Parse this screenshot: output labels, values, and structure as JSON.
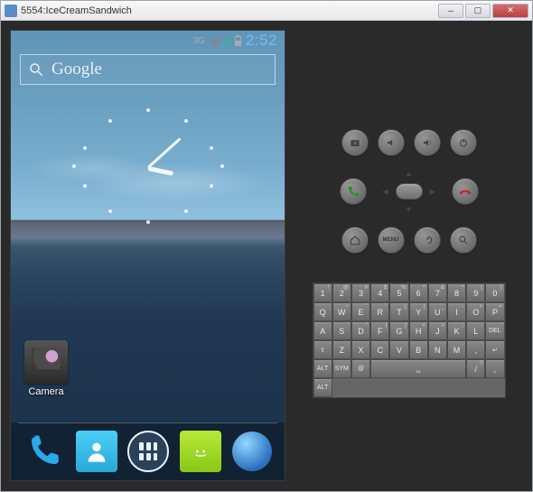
{
  "window": {
    "title": "5554:IceCreamSandwich"
  },
  "status": {
    "network": "3G",
    "time": "2:52"
  },
  "search": {
    "placeholder": "Google"
  },
  "homescreen": {
    "apps": [
      {
        "label": "Camera"
      }
    ]
  },
  "dock": {
    "items": [
      "phone",
      "contacts",
      "apps",
      "messaging",
      "browser"
    ]
  },
  "controls": {
    "row1": [
      "camera",
      "vol-down",
      "vol-up",
      "power"
    ],
    "row2": [
      "call",
      "dpad",
      "end"
    ],
    "row3": [
      "home",
      "menu",
      "back",
      "search"
    ],
    "menu_label": "MENU"
  },
  "keyboard": {
    "rows": [
      [
        {
          "main": "1",
          "sup": "!"
        },
        {
          "main": "2",
          "sup": "@"
        },
        {
          "main": "3",
          "sup": "#"
        },
        {
          "main": "4",
          "sup": "$"
        },
        {
          "main": "5",
          "sup": "%"
        },
        {
          "main": "6",
          "sup": "^"
        },
        {
          "main": "7",
          "sup": "&"
        },
        {
          "main": "8",
          "sup": "*"
        },
        {
          "main": "9",
          "sup": "("
        },
        {
          "main": "0",
          "sup": ")"
        }
      ],
      [
        {
          "main": "Q"
        },
        {
          "main": "W",
          "sup": "~"
        },
        {
          "main": "E",
          "sup": "¯"
        },
        {
          "main": "R",
          "sup": "`"
        },
        {
          "main": "T",
          "sup": "{"
        },
        {
          "main": "Y",
          "sup": "}"
        },
        {
          "main": "U",
          "sup": "_"
        },
        {
          "main": "I",
          "sup": "-"
        },
        {
          "main": "O",
          "sup": "+"
        },
        {
          "main": "P",
          "sup": "="
        }
      ],
      [
        {
          "main": "A"
        },
        {
          "main": "S",
          "sup": "'"
        },
        {
          "main": "D",
          "sup": "\""
        },
        {
          "main": "F",
          "sup": "["
        },
        {
          "main": "G",
          "sup": "]"
        },
        {
          "main": "H",
          "sup": "<"
        },
        {
          "main": "J",
          "sup": ">"
        },
        {
          "main": "K",
          "sup": ";"
        },
        {
          "main": "L",
          "sup": ":"
        },
        {
          "main": "DEL",
          "fn": true
        }
      ],
      [
        {
          "main": "⇧",
          "fn": true
        },
        {
          "main": "Z"
        },
        {
          "main": "X"
        },
        {
          "main": "C"
        },
        {
          "main": "V"
        },
        {
          "main": "B"
        },
        {
          "main": "N"
        },
        {
          "main": "M",
          "sup": "."
        },
        {
          "main": ",",
          "sup": ""
        },
        {
          "main": "↵",
          "fn": true
        }
      ],
      [
        {
          "main": "ALT",
          "fn": true
        },
        {
          "main": "SYM",
          "fn": true
        },
        {
          "main": "@",
          "fn": true
        },
        {
          "main": "␣",
          "wide": 5,
          "fn": true
        },
        {
          "main": "/",
          "sup": "?"
        },
        {
          "main": ",",
          "sup": ""
        },
        {
          "main": "ALT",
          "fn": true
        }
      ]
    ]
  }
}
